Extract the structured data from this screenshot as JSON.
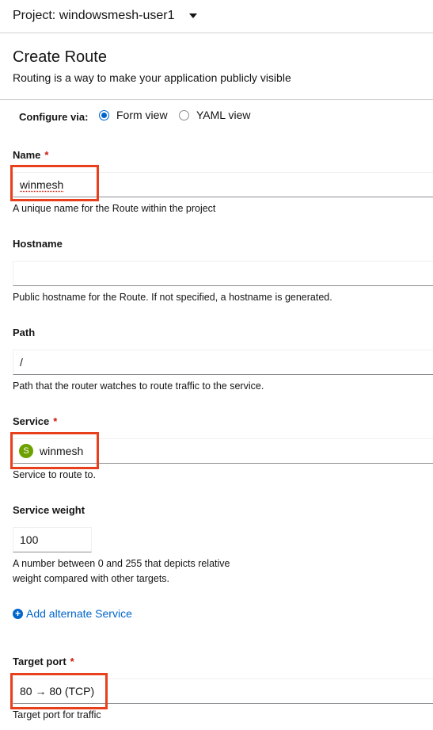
{
  "project_bar": {
    "label": "Project: windowsmesh-user1"
  },
  "header": {
    "title": "Create Route",
    "subtitle": "Routing is a way to make your application publicly visible"
  },
  "configure": {
    "label": "Configure via:",
    "options": [
      {
        "label": "Form view",
        "selected": true
      },
      {
        "label": "YAML view",
        "selected": false
      }
    ]
  },
  "form": {
    "name": {
      "label": "Name",
      "required": "*",
      "value": "winmesh",
      "helper": "A unique name for the Route within the project"
    },
    "hostname": {
      "label": "Hostname",
      "value": "",
      "helper": "Public hostname for the Route. If not specified, a hostname is generated."
    },
    "path": {
      "label": "Path",
      "value": "/",
      "helper": "Path that the router watches to route traffic to the service."
    },
    "service": {
      "label": "Service",
      "required": "*",
      "badge": "S",
      "value": "winmesh",
      "helper": "Service to route to."
    },
    "service_weight": {
      "label": "Service weight",
      "value": "100",
      "helper_line1": "A number between 0 and 255 that depicts relative",
      "helper_line2": "weight compared with other targets."
    },
    "add_alternate": {
      "label": "Add alternate Service"
    },
    "target_port": {
      "label": "Target port",
      "required": "*",
      "value": "80 → 80 (TCP)",
      "helper": "Target port for traffic"
    }
  },
  "colors": {
    "accent": "#0066cc",
    "required": "#c9190b",
    "highlight": "#e8401c",
    "service_badge": "#6ca100"
  }
}
